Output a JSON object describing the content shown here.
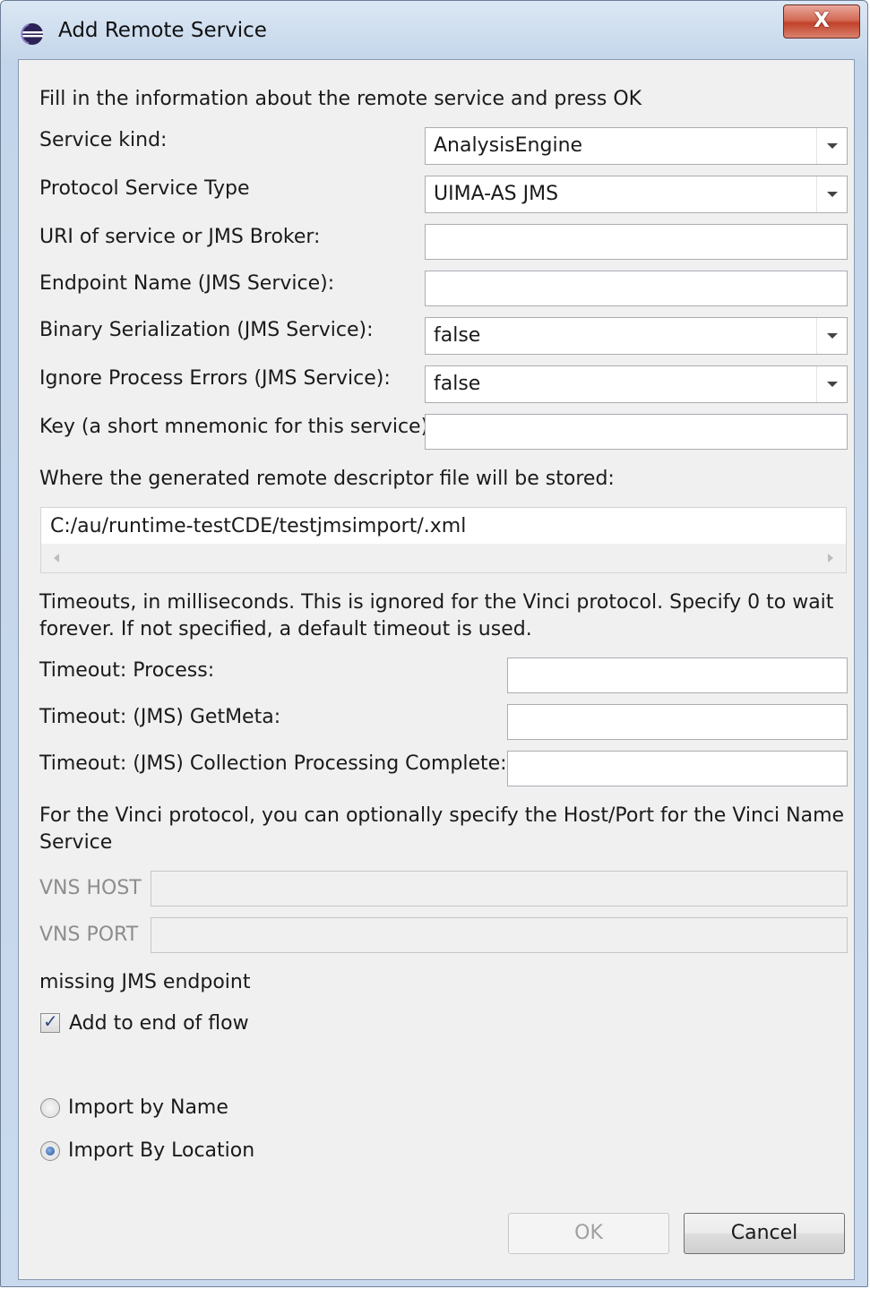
{
  "window": {
    "title": "Add Remote Service",
    "close_label": "X"
  },
  "intro_text": "Fill in the information about the remote service and press OK",
  "form": {
    "service_kind": {
      "label": "Service kind:",
      "value": "AnalysisEngine"
    },
    "protocol_service_type": {
      "label": "Protocol Service Type",
      "value": "UIMA-AS JMS"
    },
    "uri": {
      "label": "URI of service or JMS Broker:",
      "value": ""
    },
    "endpoint_name": {
      "label": "Endpoint Name (JMS Service):",
      "value": ""
    },
    "binary_serialization": {
      "label": "Binary Serialization (JMS Service):",
      "value": "false"
    },
    "ignore_process_errors": {
      "label": "Ignore Process Errors (JMS Service):",
      "value": "false"
    },
    "key": {
      "label": "Key (a short mnemonic for this service):",
      "value": ""
    }
  },
  "descriptor": {
    "label": "Where the generated remote descriptor file will be stored:",
    "path": "C:/au/runtime-testCDE/testjmsimport/.xml"
  },
  "timeouts": {
    "description_line1": "Timeouts, in milliseconds.  This is ignored for the Vinci protocol.  Specify 0 to wait",
    "description_line2": "forever. If not specified, a default timeout is used.",
    "process_label": "Timeout: Process:",
    "getmeta_label": "Timeout: (JMS) GetMeta:",
    "cpc_label": "Timeout: (JMS) Collection Processing Complete:"
  },
  "vinci": {
    "description_line1": "For the Vinci protocol, you can optionally specify the Host/Port for the Vinci Name",
    "description_line2": "Service",
    "host_label": "VNS HOST",
    "port_label": "VNS PORT"
  },
  "status_message": "missing JMS endpoint",
  "add_to_end_of_flow": {
    "label": "Add to end of flow",
    "checked": true
  },
  "import_options": {
    "by_name": {
      "label": "Import by Name",
      "selected": false
    },
    "by_location": {
      "label": "Import By Location",
      "selected": true
    }
  },
  "buttons": {
    "ok_label": "OK",
    "cancel_label": "Cancel"
  }
}
